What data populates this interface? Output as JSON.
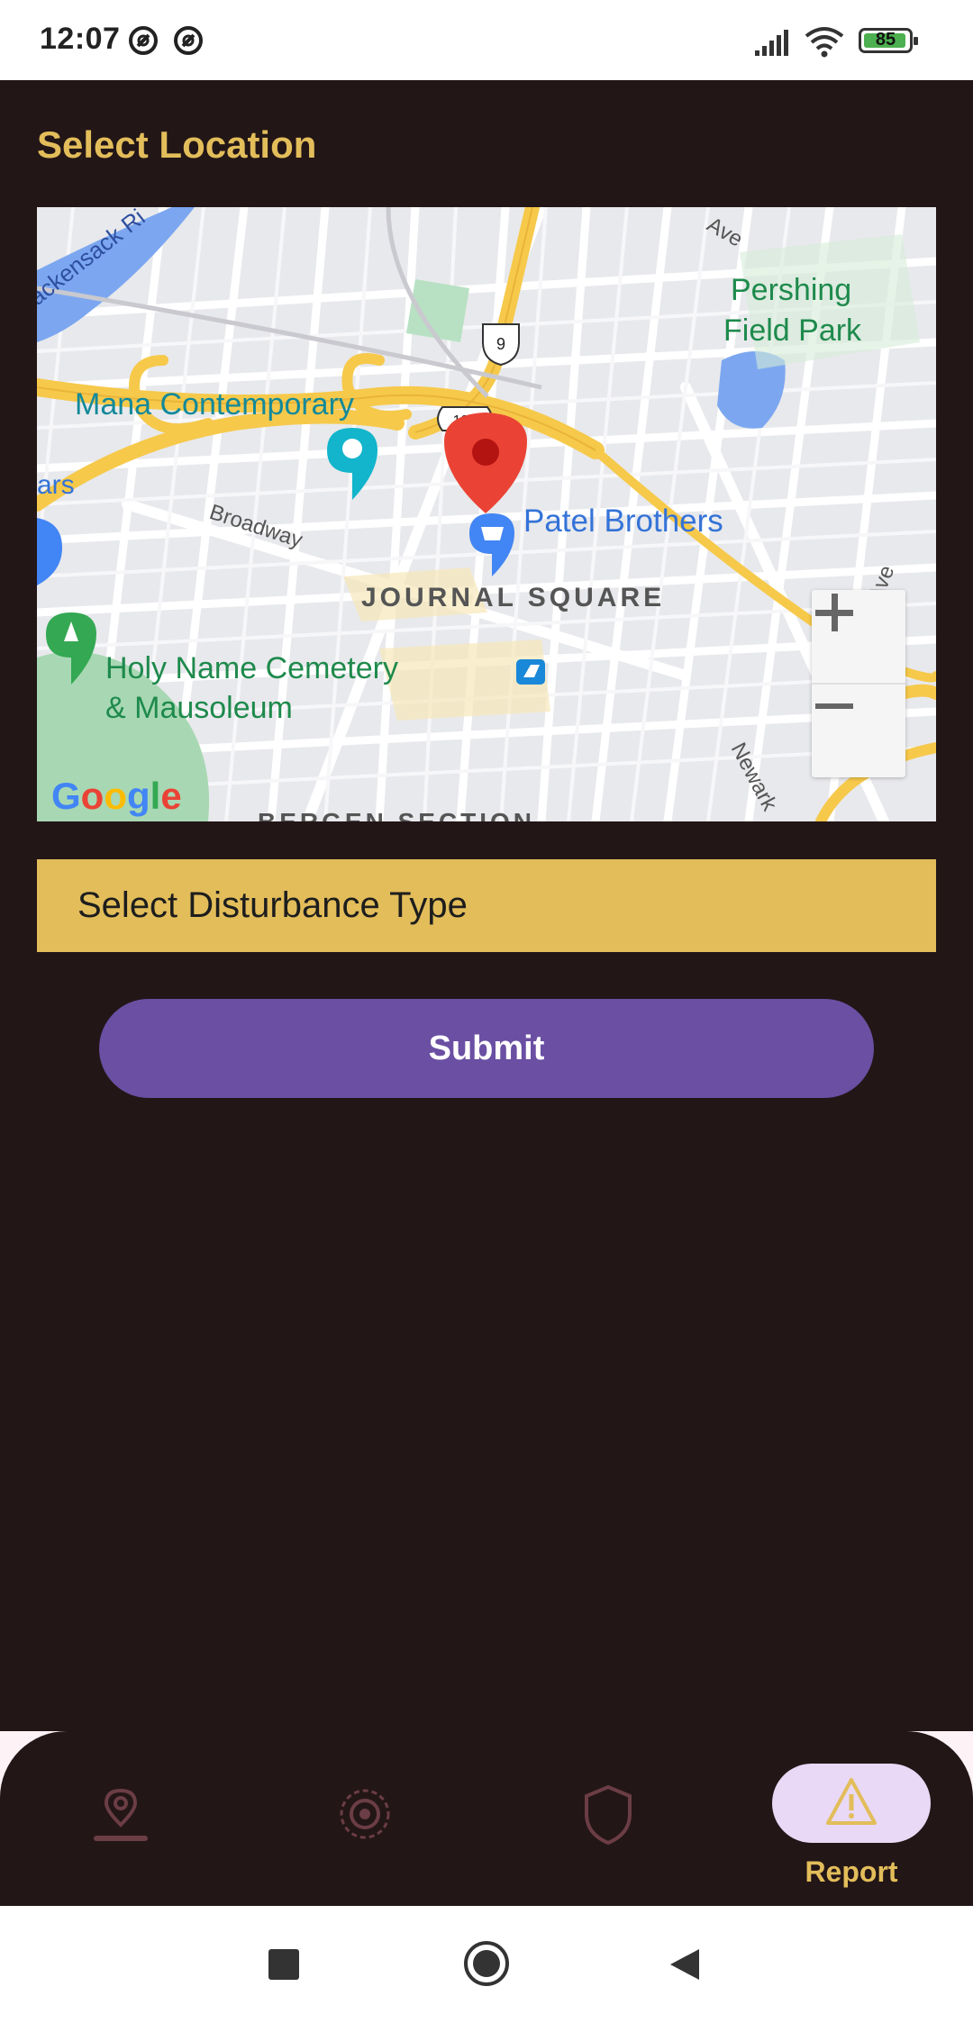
{
  "status_bar": {
    "time": "12:07",
    "battery": "85",
    "icons": [
      "no-disturb-icon",
      "no-disturb-icon",
      "signal-icon",
      "wifi-icon",
      "battery-icon"
    ]
  },
  "page": {
    "title": "Select Location"
  },
  "map": {
    "labels": {
      "mana": "Mana Contemporary",
      "pershing_1": "Pershing",
      "pershing_2": "Field Park",
      "patel": "Patel Brothers",
      "broadway": "Broadway",
      "journal": "JOURNAL SQUARE",
      "holy_1": "Holy Name Cemetery",
      "holy_2": "& Mausoleum",
      "hackensack": "ackensack Ri",
      "ars": "ars",
      "route9": "9",
      "route139": "139",
      "ave": "Ave",
      "palisade": "Palisade Ave",
      "newark": "Newark",
      "bergen": "BERGEN SECTION",
      "google": "Google"
    },
    "colors": {
      "highway": "#f6c94b",
      "park": "#a8d8b3",
      "water": "#7ca7f0",
      "marker": "#ea4335"
    }
  },
  "form": {
    "disturbance_placeholder": "Select Disturbance Type",
    "submit_label": "Submit"
  },
  "bottom_nav": {
    "items": [
      {
        "icon": "location-pin-icon",
        "label": ""
      },
      {
        "icon": "radar-icon",
        "label": ""
      },
      {
        "icon": "shield-icon",
        "label": ""
      },
      {
        "icon": "warning-icon",
        "label": "Report"
      }
    ],
    "active": "Report"
  },
  "theme": {
    "background": "#231617",
    "accent": "#e2bd5a",
    "button": "#6a4fa3",
    "pill": "#e9d9f6"
  }
}
